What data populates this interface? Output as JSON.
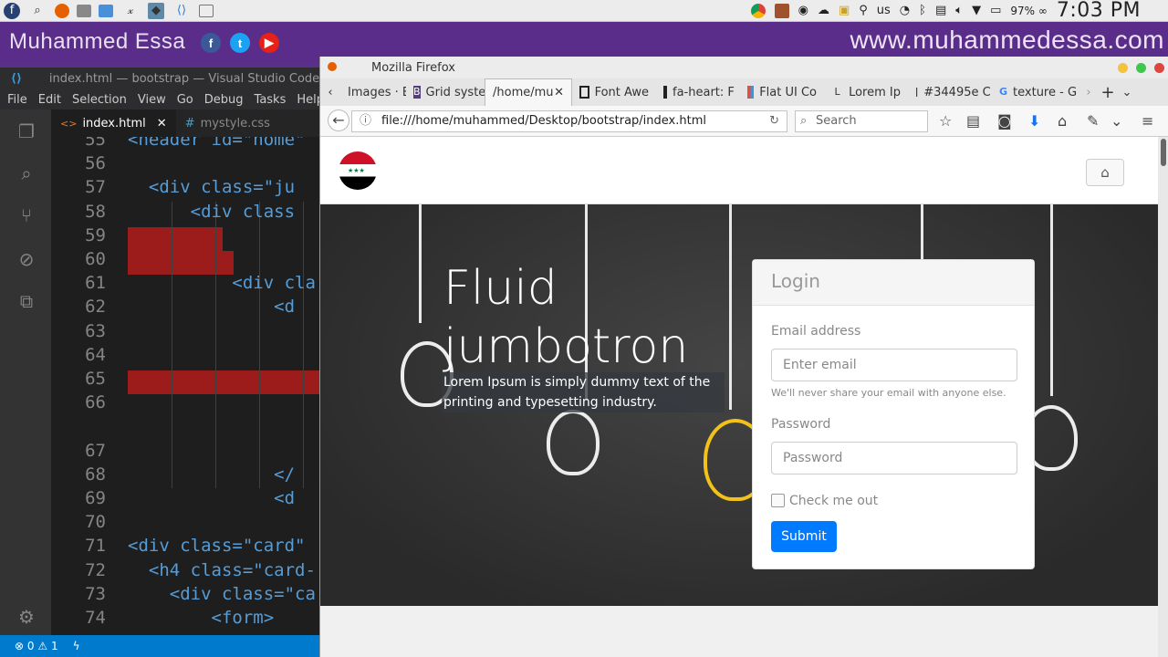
{
  "taskbar": {
    "lang": "us",
    "battery": "97% ∞",
    "clock": "7:03 PM"
  },
  "banner": {
    "name": "Muhammed Essa",
    "url": "www.muhammedessa.com"
  },
  "vscode": {
    "title": "index.html — bootstrap — Visual Studio Code",
    "menu": [
      "File",
      "Edit",
      "Selection",
      "View",
      "Go",
      "Debug",
      "Tasks",
      "Help"
    ],
    "tabs": [
      {
        "label": "index.html"
      },
      {
        "label": "mystyle.css"
      }
    ],
    "lines": [
      {
        "n": "55",
        "code": "<header id=\"home\""
      },
      {
        "n": "56",
        "code": ""
      },
      {
        "n": "57",
        "code": "  <div class=\"ju"
      },
      {
        "n": "58",
        "code": "      <div class"
      },
      {
        "n": "59",
        "code": ""
      },
      {
        "n": "60",
        "code": ""
      },
      {
        "n": "61",
        "code": "          <div cla"
      },
      {
        "n": "62",
        "code": "              <d"
      },
      {
        "n": "63",
        "code": ""
      },
      {
        "n": "64",
        "code": ""
      },
      {
        "n": "65",
        "code": ""
      },
      {
        "n": "66",
        "code": ""
      },
      {
        "n": "67",
        "code": ""
      },
      {
        "n": "68",
        "code": "              </"
      },
      {
        "n": "69",
        "code": "              <d"
      },
      {
        "n": "70",
        "code": ""
      },
      {
        "n": "71",
        "code": "<div class=\"card\""
      },
      {
        "n": "72",
        "code": "  <h4 class=\"card-"
      },
      {
        "n": "73",
        "code": "    <div class=\"ca"
      },
      {
        "n": "74",
        "code": "        <form>"
      }
    ],
    "status": {
      "errors": "0",
      "warnings": "1"
    }
  },
  "firefox": {
    "window_title": "Mozilla Firefox",
    "tabs": [
      {
        "label": "Images · E",
        "icon": "image-icon"
      },
      {
        "label": "Grid syste",
        "icon": "bootstrap-icon"
      },
      {
        "label": "/home/mu",
        "icon": "page-icon"
      },
      {
        "label": "Font Awe",
        "icon": "font-awesome-icon"
      },
      {
        "label": "fa-heart: F",
        "icon": "font-awesome-icon"
      },
      {
        "label": "Flat UI Co",
        "icon": "flat-ui-icon"
      },
      {
        "label": "Lorem Ip",
        "icon": "lorem-icon"
      },
      {
        "label": "#34495e C",
        "icon": "color-icon"
      },
      {
        "label": "texture - G",
        "icon": "google-icon"
      }
    ],
    "url": "file:///home/muhammed/Desktop/bootstrap/index.html",
    "search_placeholder": "Search"
  },
  "site": {
    "jumbotron": {
      "title_line1": "Fluid",
      "title_line2": "jumbotron",
      "lead_line1": "Lorem Ipsum is simply dummy text of the",
      "lead_line2": "printing and typesetting industry."
    },
    "login": {
      "header": "Login",
      "email_label": "Email address",
      "email_placeholder": "Enter email",
      "email_help": "We'll never share your email with anyone else.",
      "password_label": "Password",
      "password_placeholder": "Password",
      "check_label": "Check me out",
      "submit": "Submit"
    }
  }
}
